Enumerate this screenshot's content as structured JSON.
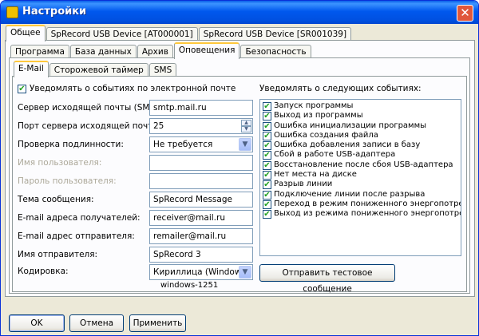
{
  "window": {
    "title": "Настройки",
    "close_glyph": "✕"
  },
  "tabs_level1": [
    "Общее",
    "SpRecord USB Device [AT000001]",
    "SpRecord USB Device [SR001039]"
  ],
  "tabs_level2": [
    "Программа",
    "База данных",
    "Архив",
    "Оповещения",
    "Безопасность"
  ],
  "tabs_level3": [
    "E-Mail",
    "Сторожевой таймер",
    "SMS"
  ],
  "email": {
    "notify_checkbox_label": "Уведомлять о событиях по электронной почте",
    "notify_checked": true,
    "smtp_label": "Сервер исходящей почты (SMTP):",
    "smtp_value": "smtp.mail.ru",
    "port_label": "Порт сервера исходящей почты:",
    "port_value": "25",
    "auth_label": "Проверка подлинности:",
    "auth_value": "Не требуется",
    "username_label": "Имя пользователя:",
    "username_value": "",
    "password_label": "Пароль пользователя:",
    "password_value": "",
    "subject_label": "Тема сообщения:",
    "subject_value": "SpRecord Message",
    "recipients_label": "E-mail адреса получателей:",
    "recipients_value": "receiver@mail.ru",
    "sender_label": "E-mail адрес отправителя:",
    "sender_value": "remailer@mail.ru",
    "sender_name_label": "Имя отправителя:",
    "sender_name_value": "SpRecord 3",
    "encoding_label": "Кодировка:",
    "encoding_value": "Кириллица (Windows)",
    "encoding_code": "windows-1251"
  },
  "events": {
    "header": "Уведомлять о следующих событиях:",
    "items": [
      {
        "label": "Запуск программы",
        "checked": true
      },
      {
        "label": "Выход из программы",
        "checked": true
      },
      {
        "label": "Ошибка инициализации программы",
        "checked": true
      },
      {
        "label": "Ошибка создания файла",
        "checked": true
      },
      {
        "label": "Ошибка добавления записи в базу",
        "checked": true
      },
      {
        "label": "Сбой в работе USB-адаптера",
        "checked": true
      },
      {
        "label": "Восстановление после сбоя USB-адаптера",
        "checked": true
      },
      {
        "label": "Нет места на диске",
        "checked": true
      },
      {
        "label": "Разрыв линии",
        "checked": true
      },
      {
        "label": "Подключение линии после разрыва",
        "checked": true
      },
      {
        "label": "Переход в режим пониженного энергопотребления",
        "checked": true
      },
      {
        "label": "Выход из режима пониженного энергопотребления",
        "checked": true
      }
    ],
    "test_button": "Отправить тестовое сообщение"
  },
  "buttons": {
    "ok": "OK",
    "cancel": "Отмена",
    "apply": "Применить"
  },
  "icons": {
    "check": "✔",
    "combo_arrow": "▼",
    "spin_up": "▲",
    "spin_down": "▼"
  }
}
